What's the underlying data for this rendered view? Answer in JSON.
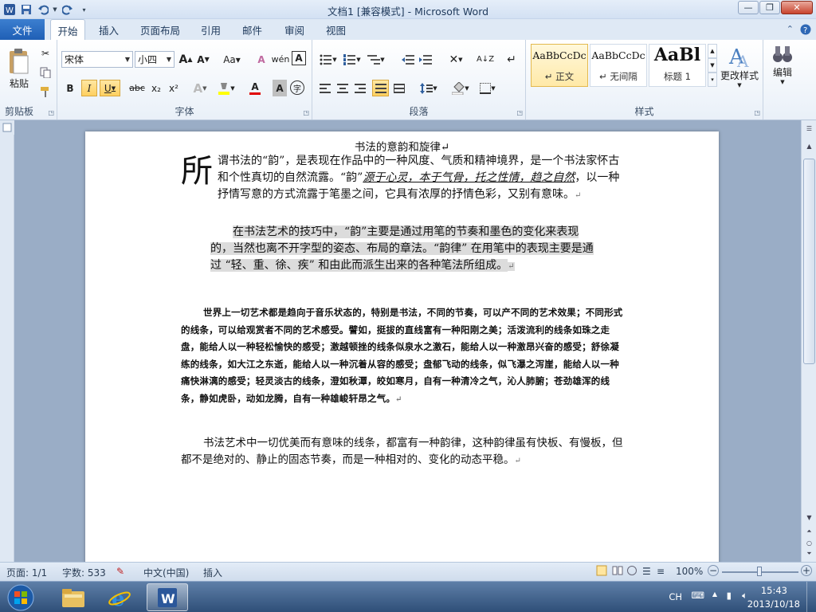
{
  "window": {
    "title": "文档1 [兼容模式] - Microsoft Word"
  },
  "tabs": {
    "file": "文件",
    "items": [
      "开始",
      "插入",
      "页面布局",
      "引用",
      "邮件",
      "审阅",
      "视图"
    ]
  },
  "ribbon": {
    "clipboard": {
      "paste": "粘贴",
      "label": "剪贴板"
    },
    "font": {
      "name": "宋体",
      "size": "小四",
      "label": "字体",
      "bold": "B",
      "italic": "I",
      "underline": "U",
      "strike": "abc",
      "sub": "x₂",
      "sup": "x²",
      "grow": "A",
      "shrink": "A",
      "case": "Aa",
      "clear": "A",
      "charborder": "A",
      "fontcolor": "A",
      "shading": "A",
      "enclose": "字"
    },
    "paragraph": {
      "label": "段落"
    },
    "styles": {
      "label": "样式",
      "items": [
        {
          "sample": "AaBbCcDc",
          "name": "↵ 正文"
        },
        {
          "sample": "AaBbCcDc",
          "name": "↵ 无间隔"
        },
        {
          "sample": "AaBl",
          "name": "标题 1"
        }
      ],
      "change": "更改样式"
    },
    "editing": {
      "label": "编辑"
    }
  },
  "document": {
    "heading": "书法的意韵和旋律↵",
    "p1_dropcap": "所",
    "p1_text": "谓书法的“韵”，是表现在作品中的一种风度、气质和精神境界，是一个书法家怀古和个性真切的自然流露。“韵”",
    "p1_emph": "源于心灵，本于气骨，托之性情，趋之自然",
    "p1_tail": "，以一种抒情写意的方式流露于笔墨之间，它具有浓厚的抒情色彩，又别有意味。",
    "p2": "在书法艺术的技巧中，“韵”主要是通过用笔的节奏和墨色的变化来表现的，当然也离不开字型的姿态、布局的章法。“韵律” 在用笔中的表现主要是通过 “轻、重、徐、疾” 和由此而派生出来的各种笔法所组成。",
    "p3": "世界上一切艺术都是趋向于音乐状态的，特别是书法，不同的节奏，可以产不同的艺术效果；不同形式的线条，可以给观赏者不同的艺术感受。譬如，挺拔的直线富有一种阳刚之美；活泼流利的线条如珠之走盘，能给人以一种轻松愉快的感受；激越顿挫的线条似泉水之激石，能给人以一种激昂兴奋的感受；舒徐凝练的线条，如大江之东逝，能给人以一种沉着从容的感受；盘郁飞动的线条，似飞瀑之泻崖，能给人以一种痛快淋漓的感受；轻灵淡古的线条，澄如秋潭，皎如寒月，自有一种清冷之气，沁人肺腑；苍劲雄浑的线条，静如虎卧，动如龙腾，自有一种雄峻轩昂之气。",
    "p4": "书法艺术中一切优美而有意味的线条，都富有一种韵律，这种韵律虽有快板、有慢板，但都不是绝对的、静止的固态节奏，而是一种相对的、变化的动态平稳。",
    "mark": "↵"
  },
  "status": {
    "page": "页面: 1/1",
    "words": "字数: 533",
    "lang": "中文(中国)",
    "mode": "插入",
    "zoom": "100%",
    "minus": "−",
    "plus": "+"
  },
  "taskbar": {
    "ime": "CH",
    "time": "15:43",
    "date": "2013/10/18"
  },
  "colors": {
    "accent": "#2b579a",
    "file_tab": "#2a6ac0",
    "highlight": "#ffff00",
    "font_red": "#e00000"
  }
}
